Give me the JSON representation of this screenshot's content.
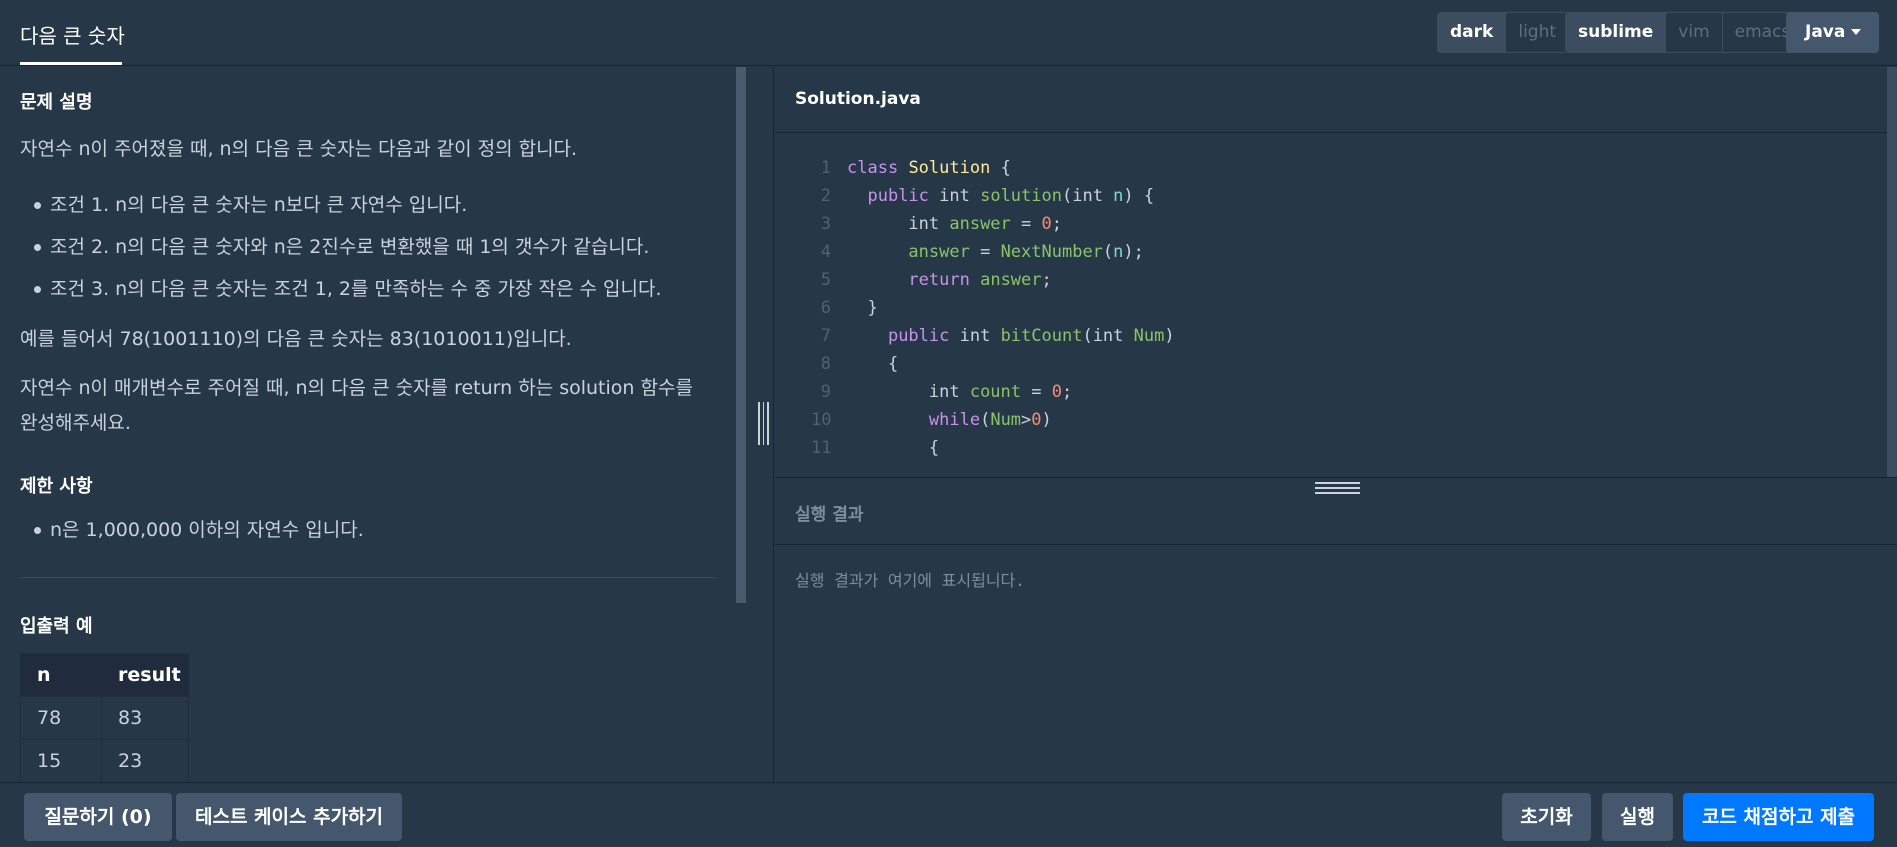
{
  "header": {
    "title": "다음 큰 숫자",
    "theme": {
      "options": [
        "dark",
        "light"
      ],
      "selected": "dark"
    },
    "keymap": {
      "options": [
        "sublime",
        "vim",
        "emacs"
      ],
      "selected": "sublime"
    },
    "language": "Java"
  },
  "problem": {
    "desc_heading": "문제 설명",
    "intro": "자연수 n이 주어졌을 때, n의 다음 큰 숫자는 다음과 같이 정의 합니다.",
    "conditions": [
      "조건 1. n의 다음 큰 숫자는 n보다 큰 자연수 입니다.",
      "조건 2. n의 다음 큰 숫자와 n은 2진수로 변환했을 때 1의 갯수가 같습니다.",
      "조건 3. n의 다음 큰 숫자는 조건 1, 2를 만족하는 수 중 가장 작은 수 입니다."
    ],
    "example": "예를 들어서 78(1001110)의 다음 큰 숫자는 83(1010011)입니다.",
    "task_line1": "자연수 n이 매개변수로 주어질 때, n의 다음 큰 숫자를 return 하는 solution 함수를",
    "task_line2": "완성해주세요.",
    "limits_heading": "제한 사항",
    "limits": [
      "n은 1,000,000 이하의 자연수 입니다."
    ],
    "io_heading": "입출력 예",
    "io_table": {
      "headers": [
        "n",
        "result"
      ],
      "rows": [
        [
          "78",
          "83"
        ],
        [
          "15",
          "23"
        ]
      ]
    }
  },
  "editor": {
    "file_name": "Solution.java",
    "line_numbers": [
      "1",
      "2",
      "3",
      "4",
      "5",
      "6",
      "7",
      "8",
      "9",
      "10",
      "11"
    ]
  },
  "result": {
    "title": "실행 결과",
    "placeholder": "실행 결과가 여기에 표시됩니다."
  },
  "footer": {
    "ask_label": "질문하기 (0)",
    "add_test_label": "테스트 케이스 추가하기",
    "reset_label": "초기화",
    "run_label": "실행",
    "submit_label": "코드 채점하고 제출"
  },
  "colors": {
    "background": "#263747",
    "primary_button": "#0078ff",
    "secondary_button": "#44576c"
  }
}
